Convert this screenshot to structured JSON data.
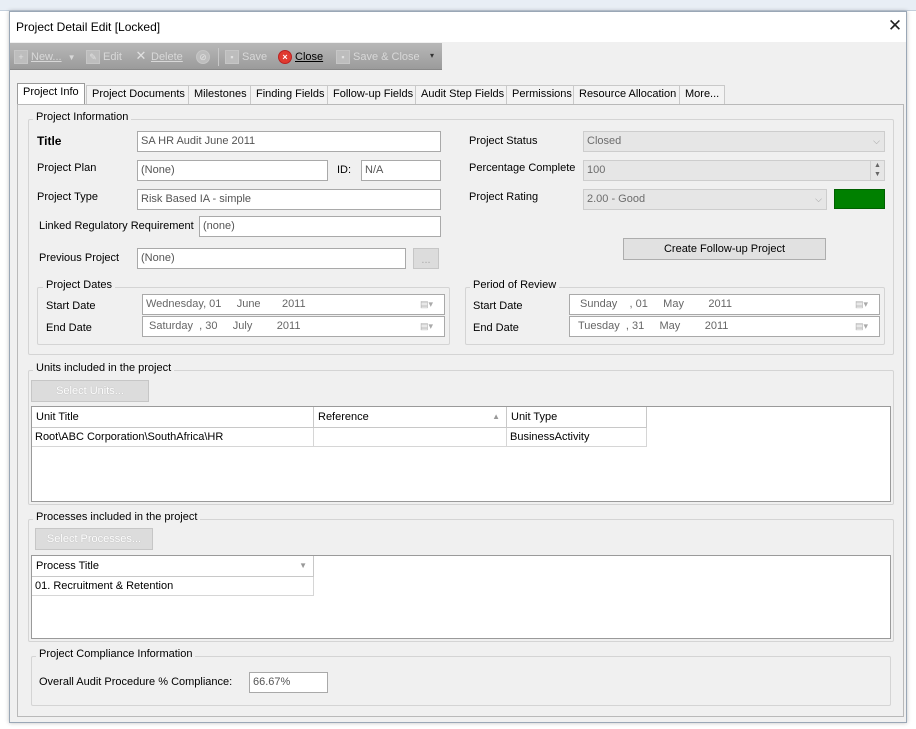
{
  "window": {
    "title": "Project Detail Edit [Locked]"
  },
  "toolbar": {
    "new_label": "New...",
    "edit_label": "Edit",
    "delete_label": "Delete",
    "save_label": "Save",
    "close_label": "Close",
    "save_close_label": "Save & Close"
  },
  "tabs": [
    "Project Info",
    "Project Documents",
    "Milestones",
    "Finding Fields",
    "Follow-up Fields",
    "Audit Step Fields",
    "Permissions",
    "Resource Allocation",
    "More..."
  ],
  "project_info": {
    "group_label": "Project Information",
    "title_label": "Title",
    "title_value": "SA HR Audit June 2011",
    "plan_label": "Project Plan",
    "plan_value": "(None)",
    "id_label": "ID:",
    "id_value": "N/A",
    "type_label": "Project Type",
    "type_value": "Risk Based IA - simple",
    "linked_label": "Linked Regulatory Requirement",
    "linked_value": "(none)",
    "previous_label": "Previous Project",
    "previous_value": "(None)",
    "browse_label": "...",
    "status_label": "Project Status",
    "status_value": "Closed",
    "percent_label": "Percentage Complete",
    "percent_value": "100",
    "rating_label": "Project Rating",
    "rating_value": "2.00 - Good",
    "rating_color": "#008000",
    "followup_button": "Create Follow-up Project"
  },
  "project_dates": {
    "group_label": "Project Dates",
    "start_label": "Start Date",
    "start_value": "Wednesday, 01     June       2011",
    "end_label": "End Date",
    "end_value": "Saturday  , 30     July        2011"
  },
  "period_review": {
    "group_label": "Period of Review",
    "start_label": "Start Date",
    "start_value": "Sunday    , 01     May        2011",
    "end_label": "End Date",
    "end_value": "Tuesday  , 31     May        2011"
  },
  "units": {
    "group_label": "Units included in the project",
    "select_button": "Select Units...",
    "columns": [
      "Unit Title",
      "Reference",
      "Unit Type"
    ],
    "rows": [
      [
        "Root\\ABC Corporation\\SouthAfrica\\HR",
        "",
        "BusinessActivity"
      ]
    ]
  },
  "processes": {
    "group_label": "Processes included in the project",
    "select_button": "Select Processes...",
    "columns": [
      "Process Title"
    ],
    "rows": [
      [
        "01. Recruitment & Retention"
      ]
    ]
  },
  "compliance": {
    "group_label": "Project Compliance Information",
    "overall_label": "Overall Audit Procedure % Compliance:",
    "overall_value": "66.67%"
  }
}
